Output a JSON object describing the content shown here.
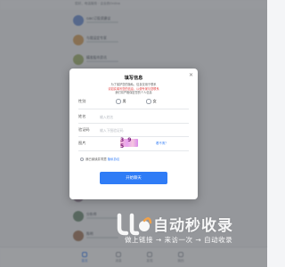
{
  "background_app": {
    "greeting": "您好，电话服务 · 企业的Online",
    "list": [
      {
        "title": "GBC订投资建议",
        "avatar_color": "#6b8fd6"
      },
      {
        "title": "与我设定专家",
        "avatar_color": "#d9a15a"
      },
      {
        "title": "精准股市资讯",
        "avatar_color": "#a3b36c"
      },
      {
        "title": "赵斌",
        "avatar_color": "#8d6b5a"
      },
      {
        "title": "黄雪",
        "avatar_color": "#b37b6a"
      },
      {
        "title": "金融王",
        "avatar_color": "#7a8fa8"
      },
      {
        "title": "李彤",
        "avatar_color": "#c2a27e"
      },
      {
        "title": "张老师",
        "avatar_color": "#5c6f86"
      },
      {
        "title": "王总",
        "avatar_color": "#9b7a61"
      },
      {
        "title": "刘静",
        "avatar_color": "#a08a9e"
      },
      {
        "title": "分析师",
        "avatar_color": "#6f8d74"
      },
      {
        "title": "陈明",
        "avatar_color": "#a6795b"
      },
      {
        "title": "柳静",
        "avatar_color": "#8a8274"
      }
    ],
    "tabs": [
      {
        "label": "首页",
        "active": true
      },
      {
        "label": "消息",
        "active": false
      },
      {
        "label": "发现",
        "active": false
      },
      {
        "label": "我的",
        "active": false
      }
    ]
  },
  "modal": {
    "title": "填写信息",
    "close_icon": "close-icon",
    "notice_line1": "为了保护您的隐私，信息仅用于联系",
    "notice_line2": "请如实填写您的信息，以便专家与您联系",
    "notice_line3": "我们将严格保密您的个人信息",
    "gender": {
      "label": "性别",
      "options": [
        "男",
        "女"
      ]
    },
    "name": {
      "label": "姓名",
      "placeholder": "输入姓名"
    },
    "code": {
      "label": "验证码",
      "placeholder": "输入下图验证码"
    },
    "captcha": {
      "label": "图片",
      "text": "3 9 5",
      "refresh": "看不清？"
    },
    "agreement": {
      "text": "我已阅读并同意",
      "link": "隐私协议"
    },
    "submit_label": "开始聊天",
    "accent_color": "#2f7cf6"
  },
  "watermark": {
    "title": "自动秒收录",
    "subtitle": "做上链接 → 来访一次 → 自动收录"
  }
}
